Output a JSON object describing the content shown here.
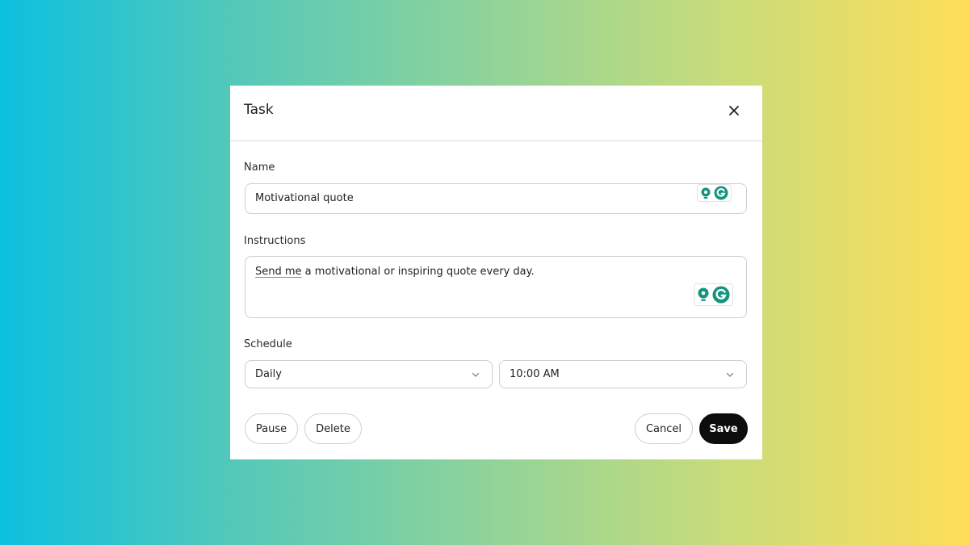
{
  "dialog": {
    "title": "Task",
    "close_icon": "close-icon"
  },
  "name": {
    "label": "Name",
    "value": "Motivational quote"
  },
  "instructions": {
    "label": "Instructions",
    "value_underlined": "Send me",
    "value_rest": " a motivational or inspiring quote every day."
  },
  "schedule": {
    "label": "Schedule",
    "frequency": "Daily",
    "time": "10:00 AM"
  },
  "buttons": {
    "pause": "Pause",
    "delete": "Delete",
    "cancel": "Cancel",
    "save": "Save"
  },
  "colors": {
    "assist_teal": "#15947f",
    "save_bg": "#0d0d0d",
    "spell_underline": "#b26cff"
  }
}
